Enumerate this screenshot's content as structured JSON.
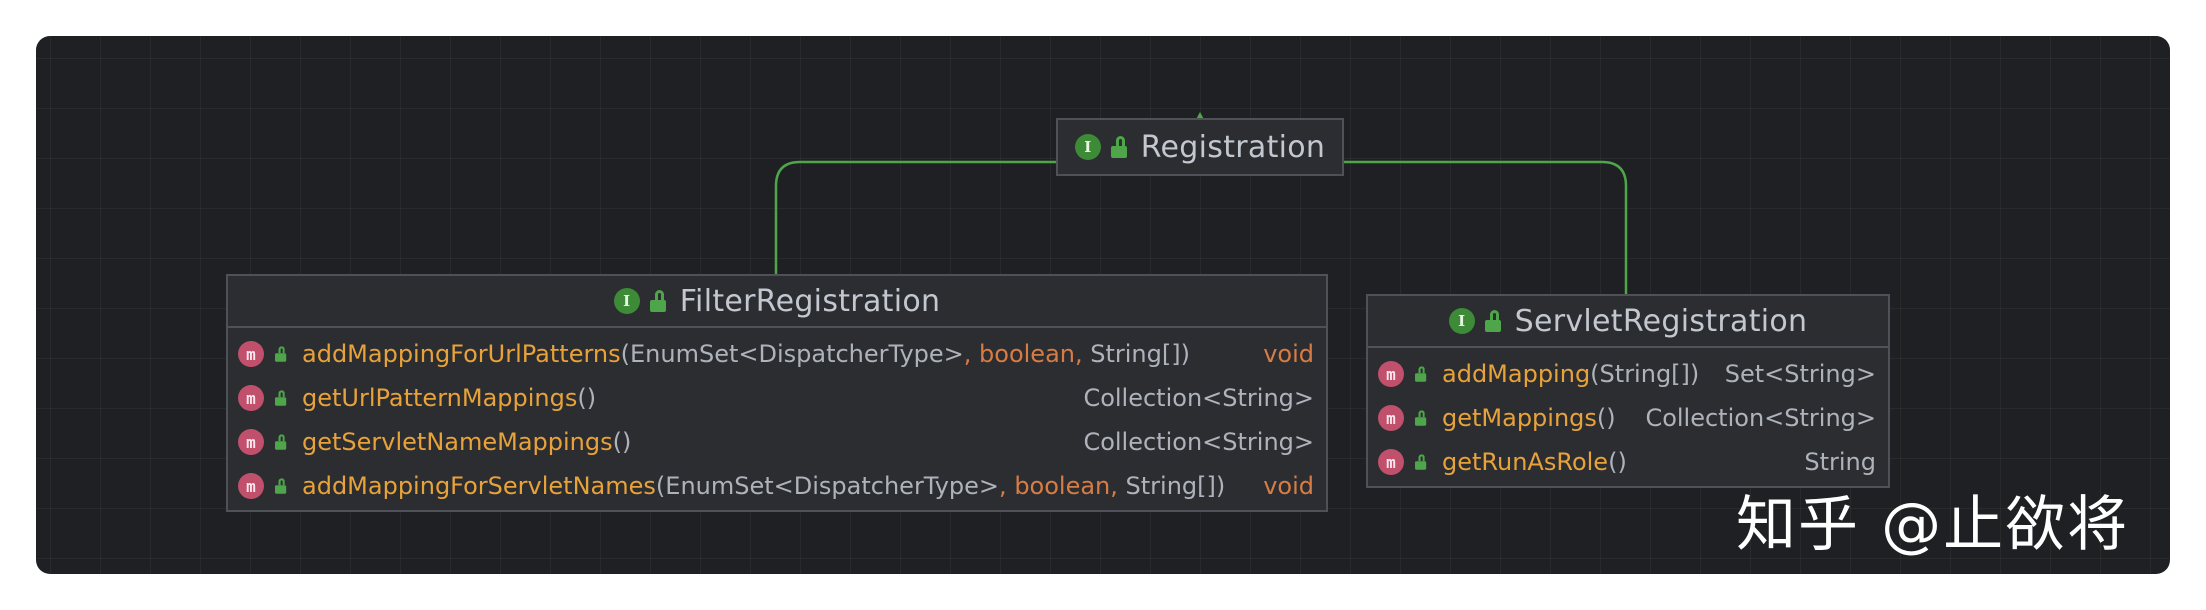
{
  "colors": {
    "connector": "#4fa64a",
    "method_name": "#e8a23a",
    "keyword": "#d77c45",
    "type": "#aeb3bb",
    "title": "#c2c7d0"
  },
  "registration": {
    "title": "Registration",
    "kind_badge": "I"
  },
  "filter_registration": {
    "title": "FilterRegistration",
    "kind_badge": "I",
    "methods": [
      {
        "badge": "m",
        "name": "addMappingForUrlPatterns",
        "params": [
          {
            "text": "EnumSet<DispatcherType>",
            "kind": "type"
          },
          {
            "text": ", ",
            "kind": "kw"
          },
          {
            "text": "boolean",
            "kind": "kw"
          },
          {
            "text": ", ",
            "kind": "kw"
          },
          {
            "text": "String[]",
            "kind": "type"
          }
        ],
        "returns": "void",
        "returns_kw": true
      },
      {
        "badge": "m",
        "name": "getUrlPatternMappings",
        "params": [],
        "returns": "Collection<String>",
        "returns_kw": false
      },
      {
        "badge": "m",
        "name": "getServletNameMappings",
        "params": [],
        "returns": "Collection<String>",
        "returns_kw": false
      },
      {
        "badge": "m",
        "name": "addMappingForServletNames",
        "params": [
          {
            "text": "EnumSet<DispatcherType>",
            "kind": "type"
          },
          {
            "text": ", ",
            "kind": "kw"
          },
          {
            "text": "boolean",
            "kind": "kw"
          },
          {
            "text": ", ",
            "kind": "kw"
          },
          {
            "text": "String[]",
            "kind": "type"
          }
        ],
        "returns": "void",
        "returns_kw": true
      }
    ]
  },
  "servlet_registration": {
    "title": "ServletRegistration",
    "kind_badge": "I",
    "methods": [
      {
        "badge": "m",
        "name": "addMapping",
        "params": [
          {
            "text": "String[]",
            "kind": "type"
          }
        ],
        "returns": "Set<String>",
        "returns_kw": false
      },
      {
        "badge": "m",
        "name": "getMappings",
        "params": [],
        "returns": "Collection<String>",
        "returns_kw": false
      },
      {
        "badge": "m",
        "name": "getRunAsRole",
        "params": [],
        "returns": "String",
        "returns_kw": false
      }
    ]
  },
  "watermark": "知乎 @止欲将"
}
